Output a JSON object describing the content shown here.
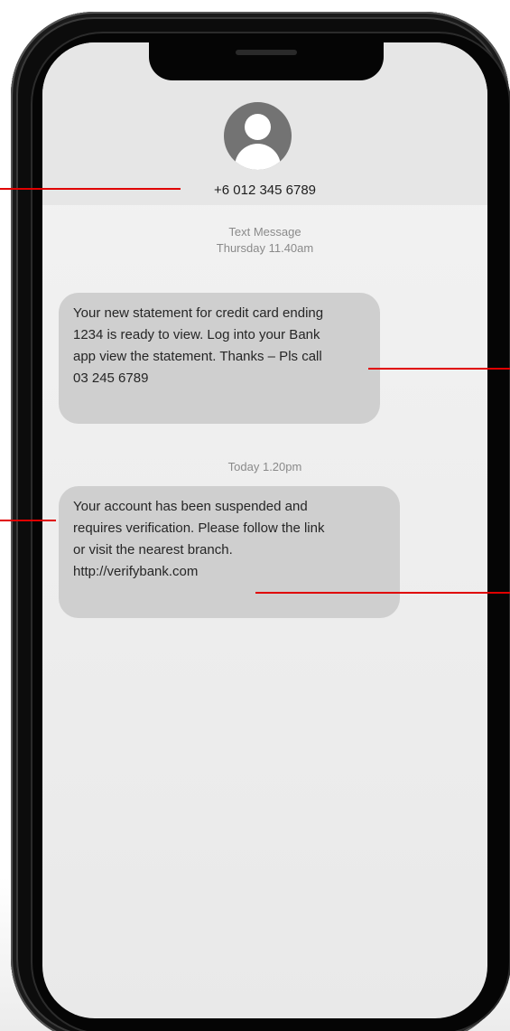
{
  "contact": {
    "number": "+6 012 345 6789",
    "avatar_icon": "person-icon"
  },
  "thread": {
    "header_label": "Text Message",
    "first_timestamp": "Thursday 11.40am",
    "second_timestamp": "Today 1.20pm"
  },
  "messages": [
    {
      "lines": [
        "Your new statement for credit card ending",
        "1234 is ready to view. Log into your Bank",
        "app view the statement. Thanks – Pls call",
        "03 245 6789"
      ]
    },
    {
      "lines": [
        "Your account has been suspended and",
        "requires verification. Please follow the link",
        "or visit the nearest branch.",
        "http://verifybank.com"
      ]
    }
  ],
  "colors": {
    "annotation": "#e00000",
    "bubble": "#cfcfcf",
    "header_bg": "#e6e6e6"
  }
}
